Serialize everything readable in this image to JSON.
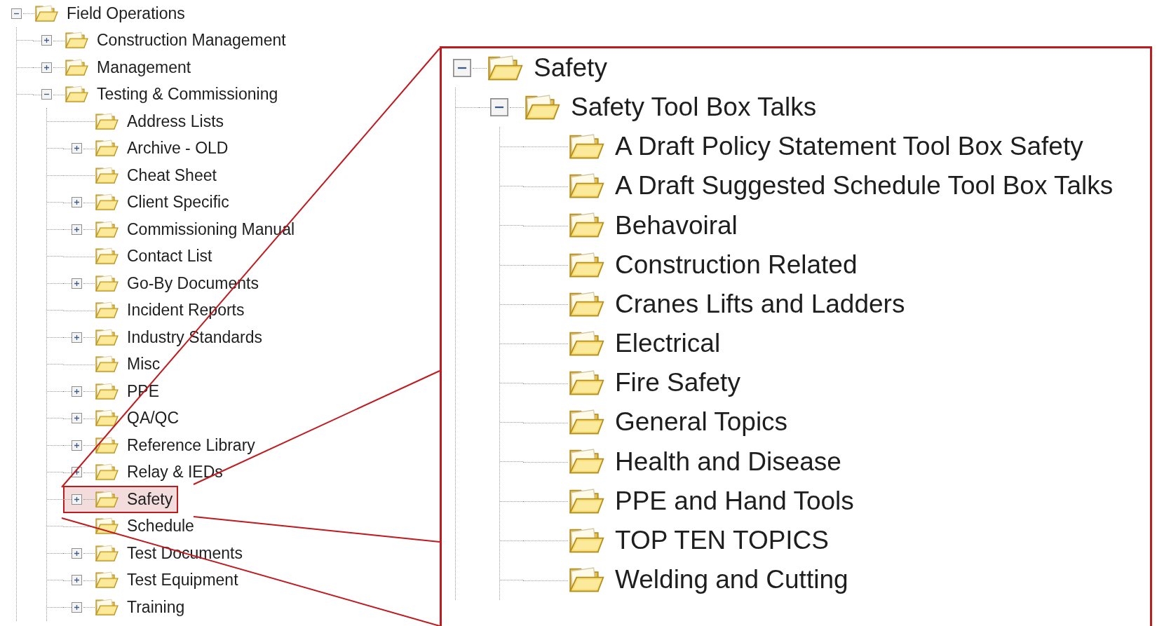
{
  "tree": {
    "label": "Field Operations",
    "expanded": true,
    "selected": false,
    "children": [
      {
        "label": "Construction Management",
        "expanded": false,
        "selected": false
      },
      {
        "label": "Management",
        "expanded": false,
        "selected": false
      },
      {
        "label": "Testing & Commissioning",
        "expanded": true,
        "selected": false,
        "children": [
          {
            "label": "Address Lists",
            "selected": false
          },
          {
            "label": "Archive - OLD",
            "expanded": false,
            "selected": false
          },
          {
            "label": "Cheat Sheet",
            "selected": false
          },
          {
            "label": "Client Specific",
            "expanded": false,
            "selected": false
          },
          {
            "label": "Commissioning Manual",
            "expanded": false,
            "selected": false
          },
          {
            "label": "Contact List",
            "selected": false
          },
          {
            "label": "Go-By Documents",
            "expanded": false,
            "selected": false
          },
          {
            "label": "Incident Reports",
            "selected": false
          },
          {
            "label": "Industry Standards",
            "expanded": false,
            "selected": false
          },
          {
            "label": "Misc",
            "selected": false
          },
          {
            "label": "PPE",
            "expanded": false,
            "selected": false
          },
          {
            "label": "QA/QC",
            "expanded": false,
            "selected": false
          },
          {
            "label": "Reference Library",
            "expanded": false,
            "selected": false
          },
          {
            "label": "Relay & IEDs",
            "expanded": false,
            "selected": false
          },
          {
            "label": "Safety",
            "expanded": false,
            "selected": true
          },
          {
            "label": "Schedule",
            "selected": false
          },
          {
            "label": "Test Documents",
            "expanded": false,
            "selected": false
          },
          {
            "label": "Test Equipment",
            "expanded": false,
            "selected": false
          },
          {
            "label": "Training",
            "expanded": false,
            "selected": false
          }
        ]
      }
    ]
  },
  "callout": {
    "tree": {
      "label": "Safety",
      "expanded": true,
      "children": [
        {
          "label": "Safety Tool Box Talks",
          "expanded": true,
          "children": [
            {
              "label": "A Draft Policy Statement Tool Box Safety"
            },
            {
              "label": "A Draft Suggested Schedule Tool Box Talks"
            },
            {
              "label": "Behavoiral"
            },
            {
              "label": "Construction Related"
            },
            {
              "label": "Cranes Lifts and Ladders"
            },
            {
              "label": "Electrical"
            },
            {
              "label": "Fire Safety"
            },
            {
              "label": "General Topics"
            },
            {
              "label": "Health and Disease"
            },
            {
              "label": "PPE and Hand Tools"
            },
            {
              "label": "TOP TEN TOPICS"
            },
            {
              "label": "Welding and Cutting"
            }
          ]
        }
      ]
    }
  }
}
